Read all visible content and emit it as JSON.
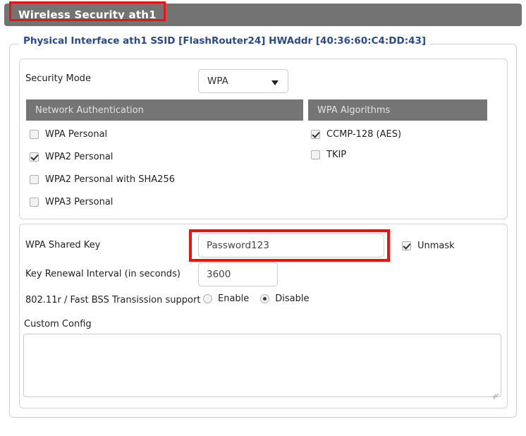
{
  "titlebar": {
    "title": "Wireless Security ath1"
  },
  "fieldset": {
    "legend": "Physical Interface ath1 SSID [FlashRouter24] HWAddr [40:36:60:C4:DD:43]"
  },
  "security_mode": {
    "label": "Security Mode",
    "value": "WPA",
    "caret_icon": "chevron-down-icon"
  },
  "network_authentication": {
    "header": "Network Authentication",
    "options": [
      {
        "label": "WPA Personal",
        "checked": false
      },
      {
        "label": "WPA2 Personal",
        "checked": true
      },
      {
        "label": "WPA2 Personal with SHA256",
        "checked": false
      },
      {
        "label": "WPA3 Personal",
        "checked": false
      }
    ]
  },
  "wpa_algorithms": {
    "header": "WPA Algorithms",
    "options": [
      {
        "label": "CCMP-128 (AES)",
        "checked": true
      },
      {
        "label": "TKIP",
        "checked": false
      }
    ]
  },
  "shared_key": {
    "label": "WPA Shared Key",
    "value": "Password123",
    "unmask_label": "Unmask",
    "unmask_checked": true
  },
  "key_renewal": {
    "label": "Key Renewal Interval (in seconds)",
    "value": "3600"
  },
  "fast_bss": {
    "label": "802.11r / Fast BSS Transission support",
    "options": [
      {
        "label": "Enable",
        "selected": false
      },
      {
        "label": "Disable",
        "selected": true
      }
    ]
  },
  "custom_config": {
    "label": "Custom Config",
    "value": ""
  },
  "colors": {
    "header_gray": "#737373",
    "column_gray": "#757575",
    "legend_blue": "#2b4a8b",
    "annotation_red": "#ee1111"
  }
}
